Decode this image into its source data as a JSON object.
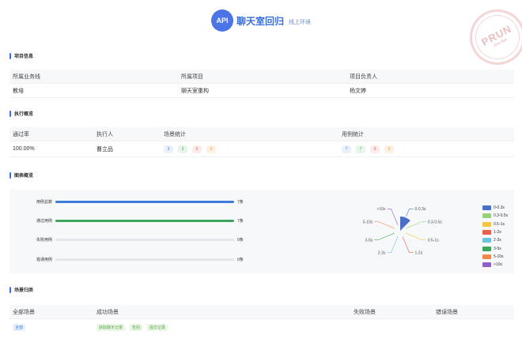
{
  "header": {
    "badge": "API",
    "title": "聊天室回归",
    "env": "线上环境",
    "stamp_big": "PRUN",
    "stamp_small": "ctra 8ye"
  },
  "project_info": {
    "section_title": "项目信息",
    "headers": [
      "所属业务线",
      "所属项目",
      "项目负责人"
    ],
    "values": [
      "教培",
      "聊天室重构",
      "杨文婷"
    ]
  },
  "execution": {
    "section_title": "执行概览",
    "headers": [
      "通过率",
      "执行人",
      "场景统计",
      "用例统计"
    ],
    "pass_rate": "100.00%",
    "executor": "曹立品",
    "scene_stats": [
      "3",
      "3",
      "0",
      "0"
    ],
    "case_stats": [
      "7",
      "7",
      "0",
      "0"
    ]
  },
  "chart_section": {
    "section_title": "图表概览"
  },
  "chart_data": [
    {
      "type": "bar",
      "categories": [
        "用例总数",
        "通过用例",
        "失败用例",
        "错误用例"
      ],
      "values": [
        7,
        7,
        0,
        0
      ],
      "labels": [
        "7条",
        "7条",
        "0条",
        "0条"
      ],
      "max": 7,
      "colors": [
        "#3b7dd8",
        "#3ea65a",
        "#d9534f",
        "#e09a3a"
      ]
    },
    {
      "type": "pie",
      "categories": [
        "0-0.3s",
        "0.3-0.5s",
        "0.5-1s",
        "1-2s",
        "2-3s",
        "3-5s",
        "5-10s",
        ">10s"
      ],
      "values": [
        7,
        0,
        0,
        0,
        0,
        0,
        0,
        0
      ],
      "colors": [
        "#4a6fc7",
        "#9bd07a",
        "#f2c544",
        "#e8604c",
        "#6cc3e0",
        "#3ea65a",
        "#f08a4b",
        "#8e5fc4"
      ],
      "legend_position": "right"
    }
  ],
  "scene_summary": {
    "section_title": "场景归类",
    "headers": [
      "全部场景",
      "成功场景",
      "失败场景",
      "错误场景"
    ],
    "all_tag": "全部",
    "success_tags": [
      "获取聊天记录",
      "告别",
      "提交记录"
    ]
  }
}
